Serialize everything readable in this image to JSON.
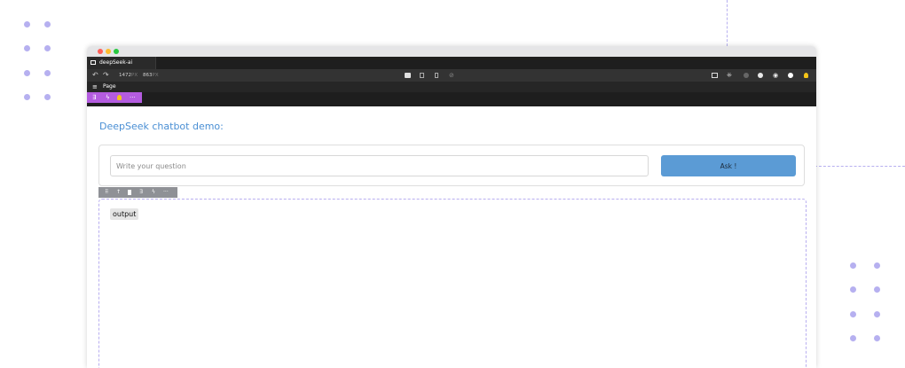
{
  "app": {
    "tab_title": "deepSeek-ai",
    "toolbar": {
      "width_value": "1472",
      "width_unit": "PX",
      "height_value": "863",
      "height_unit": "PX"
    },
    "page_menu_label": "Page"
  },
  "colors": {
    "accent_purple": "#b45ce0",
    "heading_blue": "#4a8fd4",
    "button_blue": "#5b9bd5",
    "dot_lavender": "#b6b0f0"
  },
  "component_toolbar_icons": [
    "component-icon",
    "bolt-icon",
    "bulb-icon",
    "more-icon"
  ],
  "main": {
    "heading": "DeepSeek chatbot demo:",
    "question_input": {
      "value": "",
      "placeholder": "Write your question"
    },
    "ask_button_label": "Ask !",
    "output_label": "output",
    "output_toolbar_icons": [
      "drag-handle-icon",
      "arrow-up-icon",
      "trash-icon",
      "component-icon",
      "bolt-icon",
      "more-icon"
    ]
  }
}
